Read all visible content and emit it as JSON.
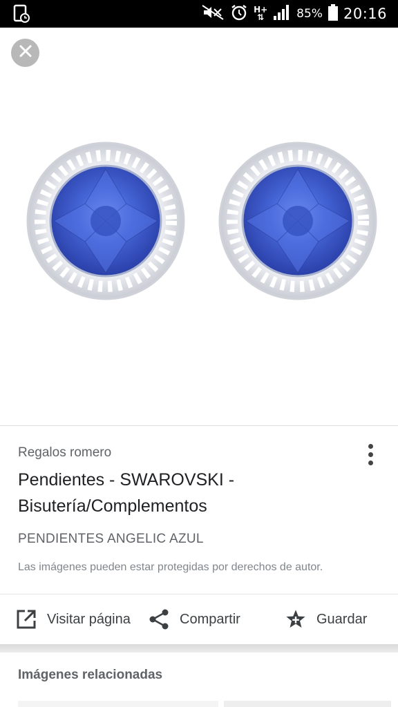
{
  "status_bar": {
    "battery": "85%",
    "time": "20:16",
    "network": "H+",
    "icons": [
      "screenshot-icon",
      "mute-icon",
      "alarm-icon",
      "network-h-plus-icon",
      "signal-icon",
      "battery-icon"
    ]
  },
  "viewer": {
    "close_icon": "close-icon",
    "image_subject": "earrings"
  },
  "info": {
    "source": "Regalos romero",
    "title": "Pendientes - SWAROVSKI - Bisutería/Complementos",
    "subtitle": "PENDIENTES ANGELIC AZUL",
    "copyright": "Las imágenes pueden estar protegidas por derechos de autor.",
    "more_icon": "more-vert-icon"
  },
  "actions": {
    "visit": {
      "label": "Visitar página",
      "icon": "open-in-new-icon"
    },
    "share": {
      "label": "Compartir",
      "icon": "share-icon"
    },
    "save": {
      "label": "Guardar",
      "icon": "star-add-icon"
    }
  },
  "related": {
    "title": "Imágenes relacionadas"
  },
  "colors": {
    "status_bar": "#000000",
    "close_button": "#b8b8b8",
    "gem_blue": "#3f5fd0",
    "text_primary": "#202124",
    "text_secondary": "#5f6368"
  }
}
